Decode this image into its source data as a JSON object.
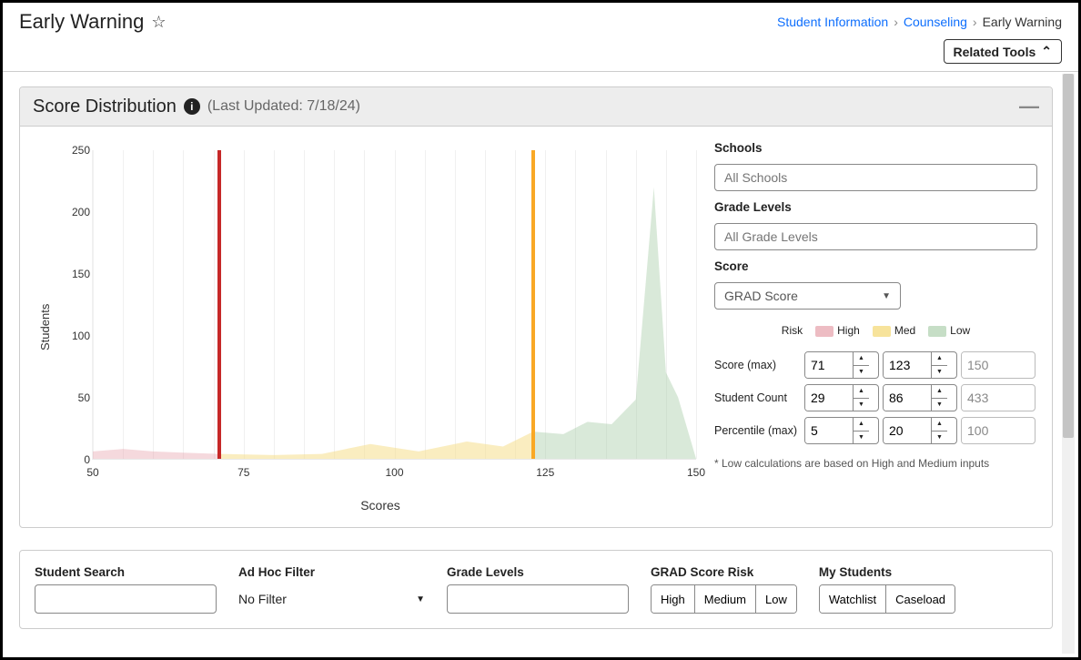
{
  "header": {
    "title": "Early Warning",
    "breadcrumb": {
      "link1": "Student Information",
      "link2": "Counseling",
      "current": "Early Warning"
    },
    "related_tools": "Related Tools"
  },
  "score_panel": {
    "title": "Score Distribution",
    "updated": "(Last Updated: 7/18/24)"
  },
  "filters": {
    "schools_label": "Schools",
    "schools_placeholder": "All Schools",
    "grade_levels_label": "Grade Levels",
    "grade_levels_placeholder": "All Grade Levels",
    "score_label": "Score",
    "score_select": "GRAD Score",
    "risk_label": "Risk",
    "risk_high": "High",
    "risk_med": "Med",
    "risk_low": "Low",
    "score_max_label": "Score (max)",
    "score_max_high": "71",
    "score_max_med": "123",
    "score_max_low": "150",
    "student_count_label": "Student Count",
    "student_count_high": "29",
    "student_count_med": "86",
    "student_count_low": "433",
    "percentile_label": "Percentile (max)",
    "percentile_high": "5",
    "percentile_med": "20",
    "percentile_low": "100",
    "note": "* Low calculations are based on High and Medium inputs"
  },
  "bottom": {
    "student_search_label": "Student Search",
    "adhoc_label": "Ad Hoc Filter",
    "adhoc_value": "No Filter",
    "grade_levels_label": "Grade Levels",
    "risk_label": "GRAD Score Risk",
    "risk_high": "High",
    "risk_medium": "Medium",
    "risk_low": "Low",
    "mystudents_label": "My Students",
    "watchlist": "Watchlist",
    "caseload": "Caseload"
  },
  "chart_data": {
    "type": "area",
    "xlabel": "Scores",
    "ylabel": "Students",
    "xlim": [
      50,
      150
    ],
    "ylim": [
      0,
      250
    ],
    "xticks": [
      50,
      75,
      100,
      125,
      150
    ],
    "yticks": [
      0,
      50,
      100,
      150,
      200,
      250
    ],
    "threshold_red": 71,
    "threshold_orange": 123,
    "series": [
      {
        "name": "High",
        "color": "rgba(230,160,170,0.4)",
        "x": [
          50,
          55,
          60,
          65,
          71
        ],
        "y": [
          6,
          8,
          6,
          5,
          4
        ]
      },
      {
        "name": "Med",
        "color": "rgba(245,220,130,0.5)",
        "x": [
          71,
          80,
          88,
          96,
          104,
          112,
          118,
          123
        ],
        "y": [
          4,
          3,
          4,
          12,
          6,
          14,
          10,
          22
        ]
      },
      {
        "name": "Low",
        "color": "rgba(160,200,160,0.4)",
        "x": [
          123,
          128,
          132,
          136,
          140,
          143,
          145,
          147,
          150
        ],
        "y": [
          22,
          20,
          30,
          28,
          48,
          220,
          70,
          50,
          0
        ]
      }
    ]
  }
}
